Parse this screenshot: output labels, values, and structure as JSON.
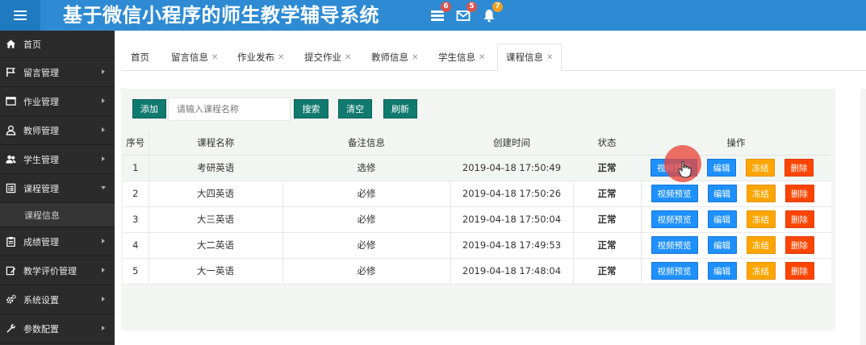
{
  "header": {
    "title": "基于微信小程序的师生教学辅导系统",
    "menu_icon": "hamburger-icon",
    "icons": [
      {
        "name": "tasks-icon",
        "badge": "6",
        "badge_color": "#d9534f"
      },
      {
        "name": "envelope-icon",
        "badge": "5",
        "badge_color": "#d9534f"
      },
      {
        "name": "bell-icon",
        "badge": "7",
        "badge_color": "#f0a020"
      }
    ]
  },
  "sidebar": {
    "items": [
      {
        "label": "首页",
        "icon": "home-icon"
      },
      {
        "label": "留言管理",
        "icon": "flag-icon"
      },
      {
        "label": "作业管理",
        "icon": "window-icon"
      },
      {
        "label": "教师管理",
        "icon": "user-icon"
      },
      {
        "label": "学生管理",
        "icon": "users-icon"
      },
      {
        "label": "课程管理",
        "icon": "list-icon",
        "expanded": true
      },
      {
        "label": "课程信息",
        "sub": true
      },
      {
        "label": "成绩管理",
        "icon": "clipboard-icon"
      },
      {
        "label": "教学评价管理",
        "icon": "edit-icon"
      },
      {
        "label": "系统设置",
        "icon": "cogs-icon"
      },
      {
        "label": "参数配置",
        "icon": "wrench-icon"
      }
    ]
  },
  "tabs": [
    {
      "label": "首页",
      "closable": false
    },
    {
      "label": "留言信息",
      "closable": true
    },
    {
      "label": "作业发布",
      "closable": true
    },
    {
      "label": "提交作业",
      "closable": true
    },
    {
      "label": "教师信息",
      "closable": true
    },
    {
      "label": "学生信息",
      "closable": true
    },
    {
      "label": "课程信息",
      "closable": true,
      "active": true
    }
  ],
  "toolbar": {
    "add_label": "添加",
    "search_placeholder": "请输入课程名称",
    "search_label": "搜索",
    "clear_label": "清空",
    "refresh_label": "刷新"
  },
  "table": {
    "columns": [
      "序号",
      "课程名称",
      "备注信息",
      "创建时间",
      "状态",
      "操作"
    ],
    "rows": [
      {
        "no": "1",
        "name": "考研英语",
        "note": "选修",
        "created": "2019-04-18 17:50:49",
        "status": "正常"
      },
      {
        "no": "2",
        "name": "大四英语",
        "note": "必修",
        "created": "2019-04-18 17:50:26",
        "status": "正常"
      },
      {
        "no": "3",
        "name": "大三英语",
        "note": "必修",
        "created": "2019-04-18 17:50:04",
        "status": "正常"
      },
      {
        "no": "4",
        "name": "大二英语",
        "note": "必修",
        "created": "2019-04-18 17:49:53",
        "status": "正常"
      },
      {
        "no": "5",
        "name": "大一英语",
        "note": "必修",
        "created": "2019-04-18 17:48:04",
        "status": "正常"
      }
    ],
    "actions": {
      "preview": "视频预览",
      "edit": "编辑",
      "freeze": "冻结",
      "delete": "删除"
    }
  },
  "colors": {
    "header": "#2e8bd3",
    "sidebar": "#2b2b2b",
    "toolbar_button": "#117a6f",
    "status_ok": "#1d7a15",
    "preview": "#1e90ff",
    "freeze": "#ffa500",
    "delete": "#ff4500"
  }
}
